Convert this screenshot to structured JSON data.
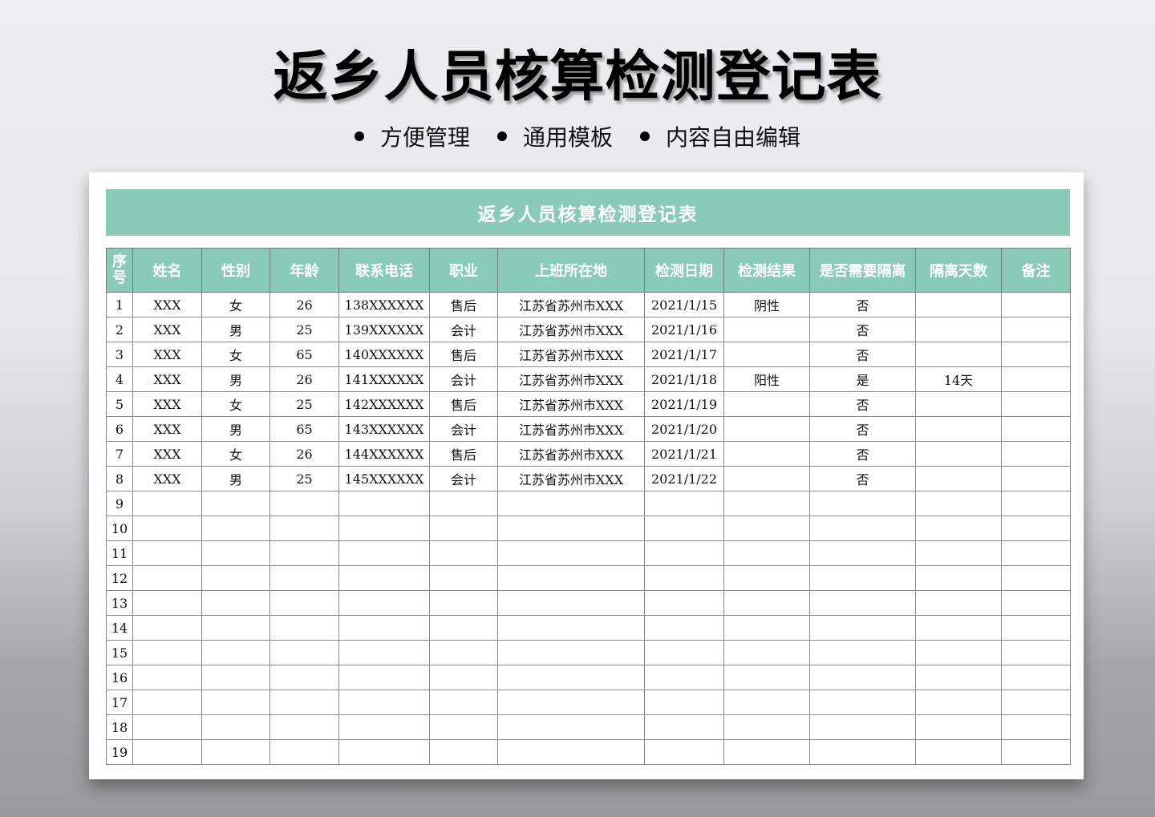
{
  "page_title": "返乡人员核算检测登记表",
  "features": [
    "方便管理",
    "通用模板",
    "内容自由编辑"
  ],
  "sheet": {
    "title": "返乡人员核算检测登记表",
    "headers": [
      "序号",
      "姓名",
      "性别",
      "年龄",
      "联系电话",
      "职业",
      "上班所在地",
      "检测日期",
      "检测结果",
      "是否需要隔离",
      "隔离天数",
      "备注"
    ],
    "rows": [
      [
        "1",
        "XXX",
        "女",
        "26",
        "138XXXXXX",
        "售后",
        "江苏省苏州市XXX",
        "2021/1/15",
        "阴性",
        "否",
        "",
        ""
      ],
      [
        "2",
        "XXX",
        "男",
        "25",
        "139XXXXXX",
        "会计",
        "江苏省苏州市XXX",
        "2021/1/16",
        "",
        "否",
        "",
        ""
      ],
      [
        "3",
        "XXX",
        "女",
        "65",
        "140XXXXXX",
        "售后",
        "江苏省苏州市XXX",
        "2021/1/17",
        "",
        "否",
        "",
        ""
      ],
      [
        "4",
        "XXX",
        "男",
        "26",
        "141XXXXXX",
        "会计",
        "江苏省苏州市XXX",
        "2021/1/18",
        "阳性",
        "是",
        "14天",
        ""
      ],
      [
        "5",
        "XXX",
        "女",
        "25",
        "142XXXXXX",
        "售后",
        "江苏省苏州市XXX",
        "2021/1/19",
        "",
        "否",
        "",
        ""
      ],
      [
        "6",
        "XXX",
        "男",
        "65",
        "143XXXXXX",
        "会计",
        "江苏省苏州市XXX",
        "2021/1/20",
        "",
        "否",
        "",
        ""
      ],
      [
        "7",
        "XXX",
        "女",
        "26",
        "144XXXXXX",
        "售后",
        "江苏省苏州市XXX",
        "2021/1/21",
        "",
        "否",
        "",
        ""
      ],
      [
        "8",
        "XXX",
        "男",
        "25",
        "145XXXXXX",
        "会计",
        "江苏省苏州市XXX",
        "2021/1/22",
        "",
        "否",
        "",
        ""
      ],
      [
        "9",
        "",
        "",
        "",
        "",
        "",
        "",
        "",
        "",
        "",
        "",
        ""
      ],
      [
        "10",
        "",
        "",
        "",
        "",
        "",
        "",
        "",
        "",
        "",
        "",
        ""
      ],
      [
        "11",
        "",
        "",
        "",
        "",
        "",
        "",
        "",
        "",
        "",
        "",
        ""
      ],
      [
        "12",
        "",
        "",
        "",
        "",
        "",
        "",
        "",
        "",
        "",
        "",
        ""
      ],
      [
        "13",
        "",
        "",
        "",
        "",
        "",
        "",
        "",
        "",
        "",
        "",
        ""
      ],
      [
        "14",
        "",
        "",
        "",
        "",
        "",
        "",
        "",
        "",
        "",
        "",
        ""
      ],
      [
        "15",
        "",
        "",
        "",
        "",
        "",
        "",
        "",
        "",
        "",
        "",
        ""
      ],
      [
        "16",
        "",
        "",
        "",
        "",
        "",
        "",
        "",
        "",
        "",
        "",
        ""
      ],
      [
        "17",
        "",
        "",
        "",
        "",
        "",
        "",
        "",
        "",
        "",
        "",
        ""
      ],
      [
        "18",
        "",
        "",
        "",
        "",
        "",
        "",
        "",
        "",
        "",
        "",
        ""
      ],
      [
        "19",
        "",
        "",
        "",
        "",
        "",
        "",
        "",
        "",
        "",
        "",
        ""
      ]
    ]
  },
  "colors": {
    "accent": "#8acab8",
    "grid_line": "#8a8a8a",
    "card": "#ffffff"
  }
}
